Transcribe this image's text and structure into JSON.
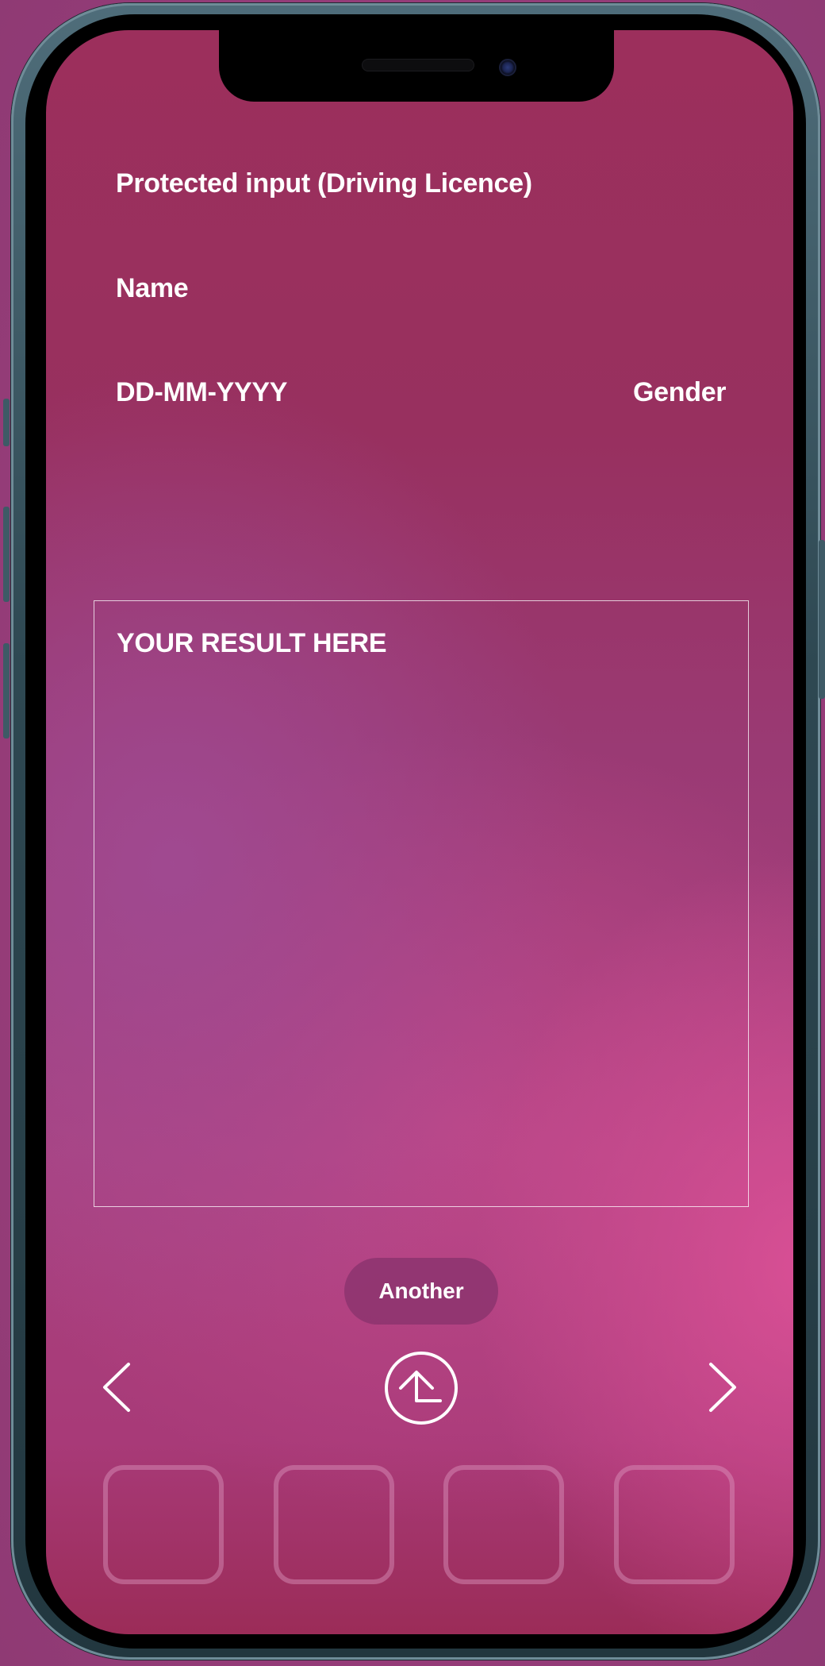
{
  "form": {
    "title": "Protected input (Driving Licence)",
    "name_label": "Name",
    "date_label": "DD-MM-YYYY",
    "gender_label": "Gender"
  },
  "result": {
    "placeholder": "YOUR RESULT HERE"
  },
  "actions": {
    "another_label": "Another"
  },
  "icons": {
    "previous": "chevron-left-icon",
    "upload": "upload-arrow-icon",
    "next": "chevron-right-icon"
  },
  "thumbnails": [
    {
      "slot": 1
    },
    {
      "slot": 2
    },
    {
      "slot": 3
    },
    {
      "slot": 4
    }
  ],
  "colors": {
    "text": "#ffffff",
    "button_bg": "#8c346e",
    "frame": "#2e4852"
  }
}
